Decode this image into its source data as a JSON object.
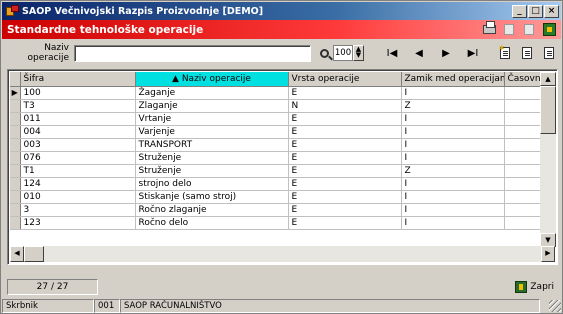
{
  "window": {
    "title": "SAOP  Večnivojski Razpis Proizvodnje [DEMO]",
    "minimize": "_",
    "maximize": "□",
    "close": "×"
  },
  "header": {
    "title": "Standardne tehnološke operacije"
  },
  "filter": {
    "label": "Naziv operacije",
    "value": "",
    "limit": "100"
  },
  "nav": {
    "first": "I◀",
    "prev": "◀",
    "next": "▶",
    "last": "▶I"
  },
  "table": {
    "columns": [
      "Šifra",
      "▲ Naziv operacije",
      "Vrsta operacije",
      "Zamik med operacijami",
      "Časovni z"
    ],
    "rows": [
      {
        "sifra": "100",
        "naziv": "Žaganje",
        "vrsta": "E",
        "zamik": "I"
      },
      {
        "sifra": "T3",
        "naziv": "Zlaganje",
        "vrsta": "N",
        "zamik": "Z"
      },
      {
        "sifra": "011",
        "naziv": "Vrtanje",
        "vrsta": "E",
        "zamik": "I"
      },
      {
        "sifra": "004",
        "naziv": "Varjenje",
        "vrsta": "E",
        "zamik": "I"
      },
      {
        "sifra": "003",
        "naziv": "TRANSPORT",
        "vrsta": "E",
        "zamik": "I"
      },
      {
        "sifra": "076",
        "naziv": "Struženje",
        "vrsta": "E",
        "zamik": "I"
      },
      {
        "sifra": "T1",
        "naziv": "Struženje",
        "vrsta": "E",
        "zamik": "Z"
      },
      {
        "sifra": "124",
        "naziv": "strojno delo",
        "vrsta": "E",
        "zamik": "I"
      },
      {
        "sifra": "010",
        "naziv": "Stiskanje (samo stroj)",
        "vrsta": "E",
        "zamik": "I"
      },
      {
        "sifra": "3",
        "naziv": "Ročno zlaganje",
        "vrsta": "E",
        "zamik": "I"
      },
      {
        "sifra": "123",
        "naziv": "Ročno delo",
        "vrsta": "E",
        "zamik": "I"
      }
    ]
  },
  "counter": "27 / 27",
  "close_label": "Zapri",
  "status": {
    "user": "Skrbnik",
    "company_code": "001",
    "company": "SAOP RAČUNALNIŠTVO"
  },
  "colors": {
    "header_red": "#cc0000",
    "sorted_column": "#00e0e0",
    "title_blue": "#0a246a"
  }
}
